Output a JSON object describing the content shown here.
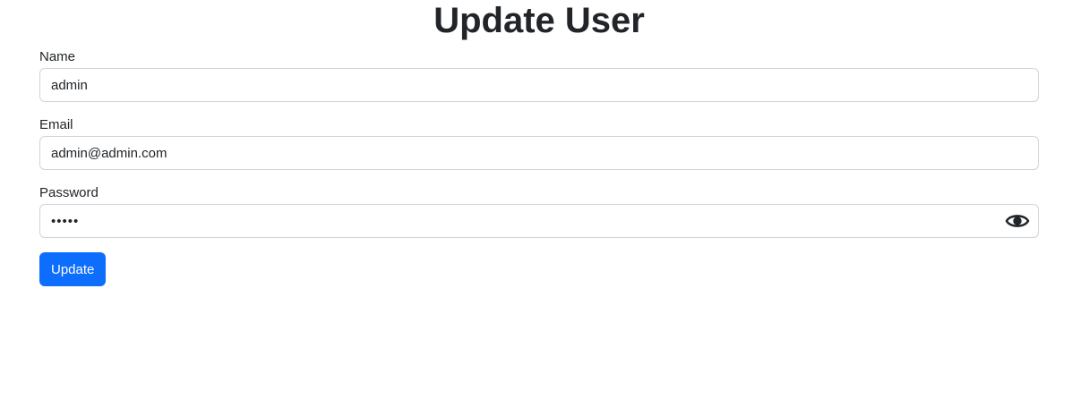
{
  "page": {
    "title": "Update User"
  },
  "form": {
    "name": {
      "label": "Name",
      "value": "admin"
    },
    "email": {
      "label": "Email",
      "value": "admin@admin.com"
    },
    "password": {
      "label": "Password",
      "value": "admin",
      "visibility_icon": "eye-icon"
    },
    "submit_label": "Update"
  },
  "colors": {
    "primary": "#0d6efd",
    "text": "#212529",
    "border": "#ced4da"
  }
}
